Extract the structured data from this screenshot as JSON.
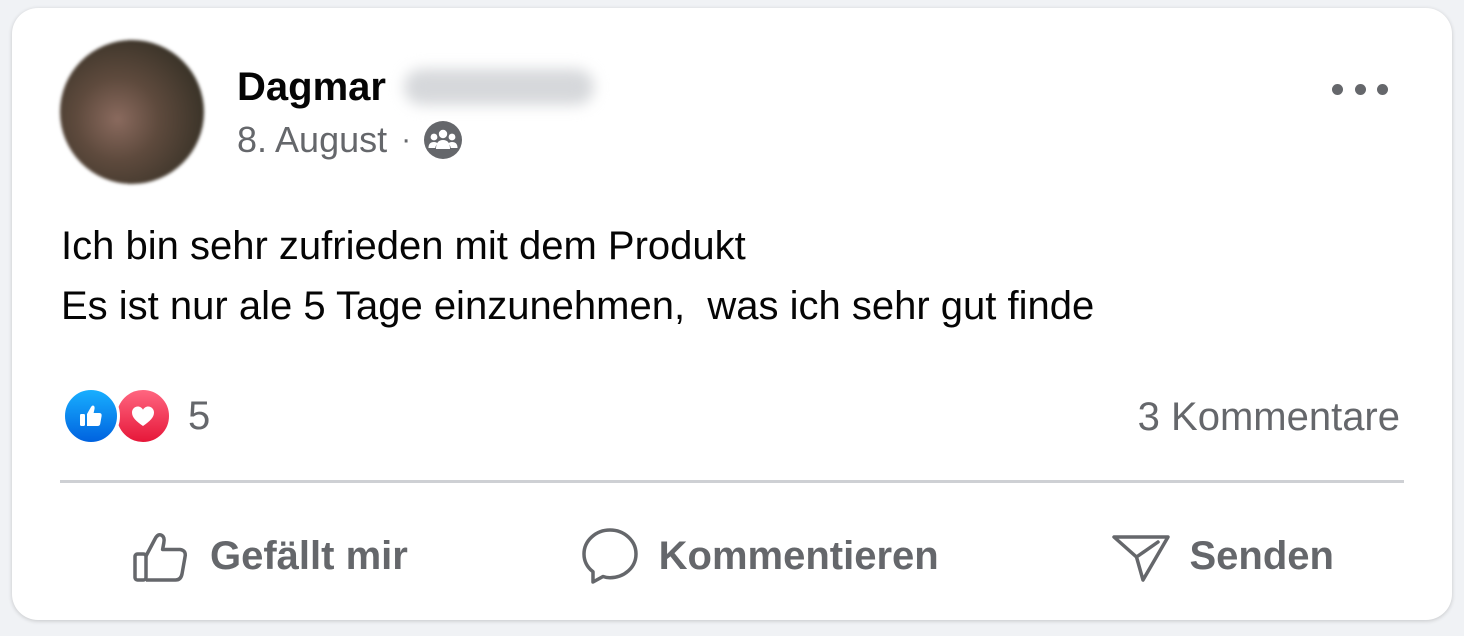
{
  "post": {
    "author_first_name": "Dagmar",
    "date": "8. August",
    "separator": "·",
    "audience_icon": "group-audience-icon",
    "body_lines": [
      "Ich bin sehr zufrieden mit dem Produkt",
      "Es ist nur ale 5 Tage einzunehmen,  was ich sehr gut finde"
    ]
  },
  "stats": {
    "reactions": [
      "like-reaction-icon",
      "love-reaction-icon"
    ],
    "reaction_count": "5",
    "comments_label": "3 Kommentare"
  },
  "actions": {
    "like_label": "Gefällt mir",
    "comment_label": "Kommentieren",
    "send_label": "Senden"
  },
  "colors": {
    "text_primary": "#050505",
    "text_secondary": "#65676b",
    "like_blue": "#0866ff",
    "love_red": "#f33e58",
    "divider": "#ced0d4"
  }
}
